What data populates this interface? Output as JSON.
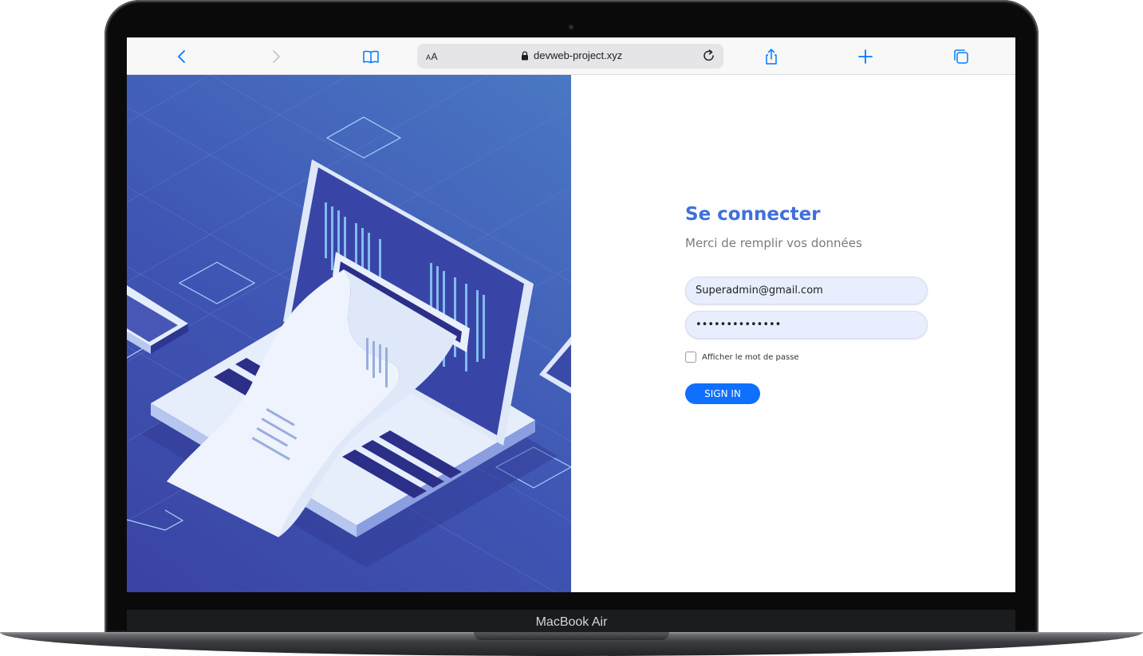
{
  "device": {
    "model_label": "MacBook Air"
  },
  "browser": {
    "text_size_button": "AA",
    "url": "devweb-project.xyz",
    "icons": {
      "back": "chevron-left-icon",
      "forward": "chevron-right-icon",
      "bookmarks": "book-icon",
      "lock": "lock-icon",
      "reload": "reload-icon",
      "share": "share-icon",
      "new_tab": "plus-icon",
      "tabs": "tabs-icon"
    },
    "accent_color": "#007aff"
  },
  "login": {
    "title": "Se connecter",
    "subtitle": "Merci de remplir vos données",
    "email_value": "Superadmin@gmail.com",
    "password_value": "••••••••••••••",
    "show_password_label": "Afficher le mot de passe",
    "show_password_checked": false,
    "signin_label": "SIGN IN",
    "colors": {
      "title": "#3f6fdb",
      "button": "#0f6fff",
      "field_bg": "#e8eefd"
    }
  },
  "illustration": {
    "subject": "isometric laptop printing a paper receipt",
    "colors": [
      "#3a43a2",
      "#4a78c4",
      "#dfe8f8"
    ]
  }
}
